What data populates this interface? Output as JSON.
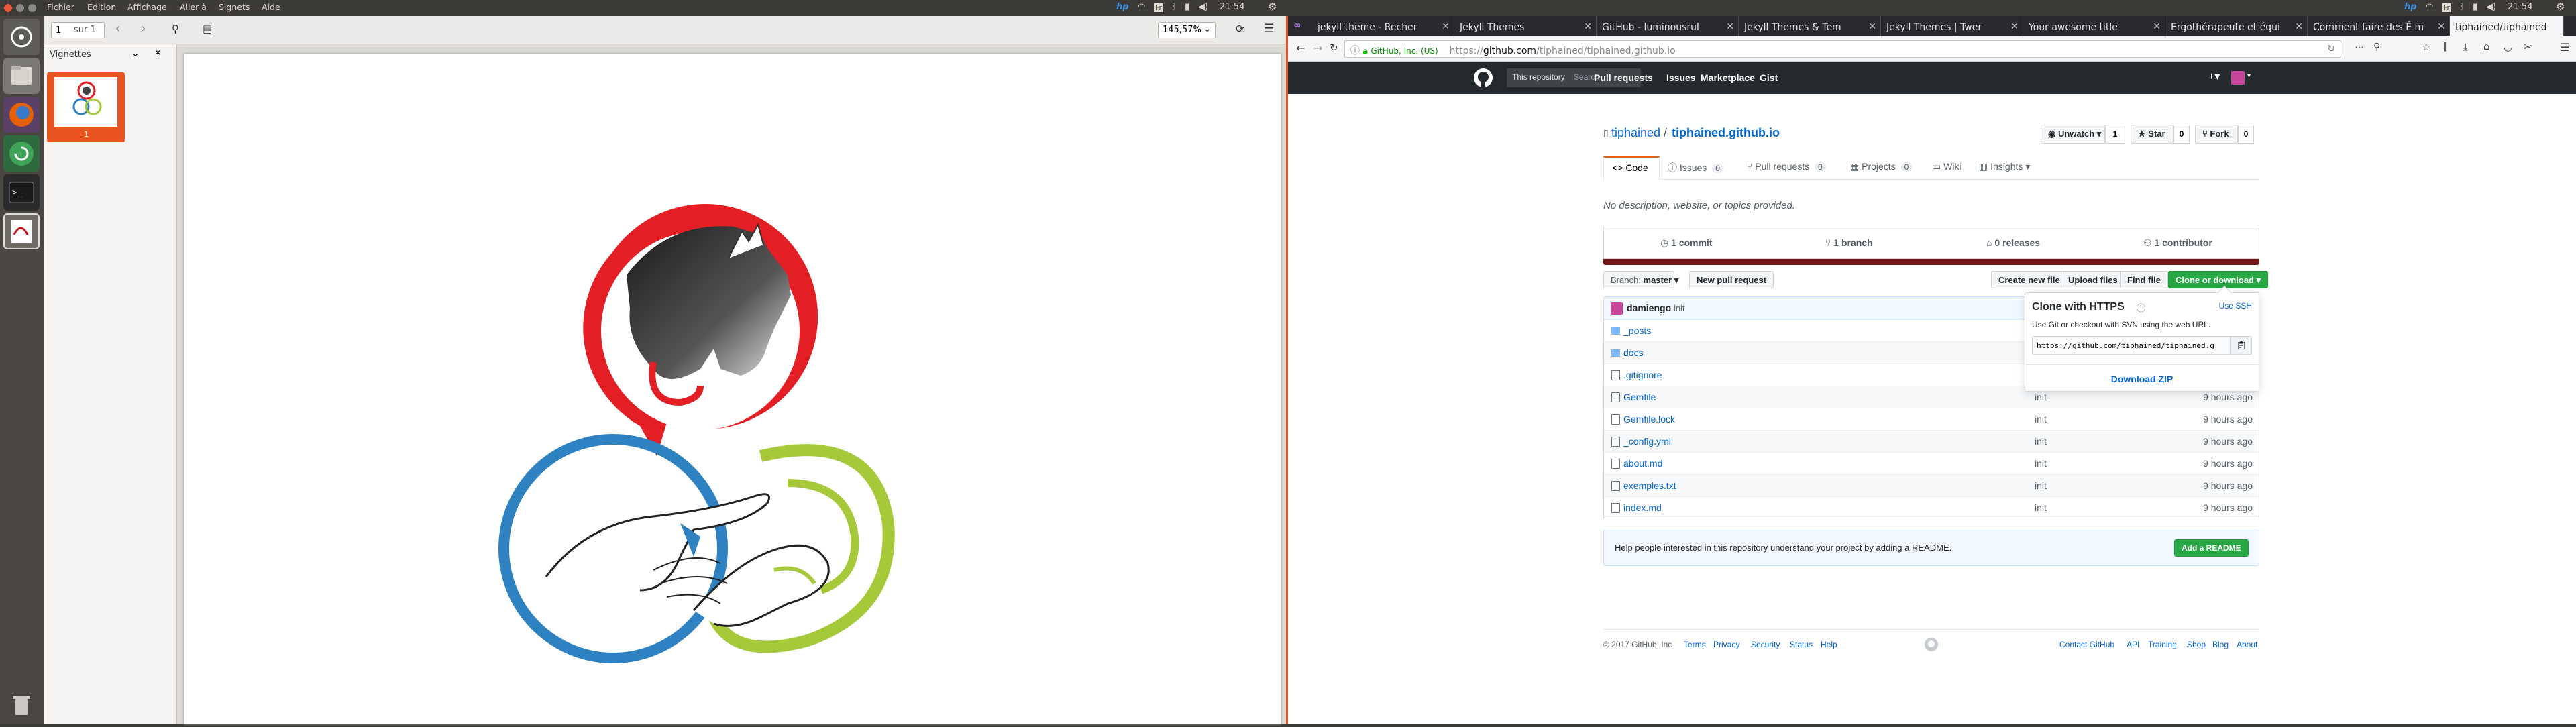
{
  "topbar": {
    "left_menu": [
      "Fichier",
      "Edition",
      "Affichage",
      "Aller à",
      "Signets",
      "Aide"
    ],
    "clock": "21:54"
  },
  "evince": {
    "page_input": "1",
    "page_total": "sur 1",
    "zoom": "145,57%",
    "sidebar_title": "Vignettes",
    "thumb_label": "1"
  },
  "colors": {
    "red": "#e31e24",
    "blue": "#2e82c1",
    "green": "#a6c93a",
    "gh_green": "#28a745",
    "gh_dark": "#24292e",
    "link": "#0366d6"
  },
  "firefox": {
    "tabs": [
      "jekyll theme - Recher",
      "Jekyll Themes",
      "GitHub - luminousrul",
      "Jekyll Themes & Tem",
      "Jekyll Themes | Twer",
      "Your awesome title",
      "Ergothérapeute et équi",
      "Comment faire des É m",
      "tiphained/tiphained"
    ],
    "identity": "GitHub, Inc. (US)",
    "url_prefix": "https://",
    "url_host": "github.com",
    "url_path": "/tiphained/tiphained.github.io"
  },
  "github": {
    "search_label": "This repository",
    "search_placeholder": "Search",
    "nav": [
      "Pull requests",
      "Issues",
      "Marketplace",
      "Gist"
    ],
    "owner": "tiphained",
    "sep": "/",
    "repo": "tiphained.github.io",
    "actions": [
      {
        "label": "Unwatch ▾",
        "count": "1"
      },
      {
        "label": "Star",
        "count": "0"
      },
      {
        "label": "Fork",
        "count": "0"
      }
    ],
    "tabs": [
      {
        "label": "Code",
        "count": ""
      },
      {
        "label": "Issues",
        "count": "0"
      },
      {
        "label": "Pull requests",
        "count": "0"
      },
      {
        "label": "Projects",
        "count": "0"
      },
      {
        "label": "Wiki",
        "count": ""
      },
      {
        "label": "Insights ▾",
        "count": ""
      }
    ],
    "description": "No description, website, or topics provided.",
    "summary": [
      "1 commit",
      "1 branch",
      "0 releases",
      "1 contributor"
    ],
    "branch_label": "Branch:",
    "branch": "master",
    "new_pr": "New pull request",
    "file_buttons": [
      "Create new file",
      "Upload files",
      "Find file"
    ],
    "clone_button": "Clone or download ▾",
    "commit_author": "damiengo",
    "commit_msg": "init",
    "files": [
      {
        "name": "_posts",
        "type": "dir",
        "msg": "",
        "time": ""
      },
      {
        "name": "docs",
        "type": "dir",
        "msg": "",
        "time": ""
      },
      {
        "name": ".gitignore",
        "type": "file",
        "msg": "",
        "time": ""
      },
      {
        "name": "Gemfile",
        "type": "file",
        "msg": "init",
        "time": "9 hours ago"
      },
      {
        "name": "Gemfile.lock",
        "type": "file",
        "msg": "init",
        "time": "9 hours ago"
      },
      {
        "name": "_config.yml",
        "type": "file",
        "msg": "init",
        "time": "9 hours ago"
      },
      {
        "name": "about.md",
        "type": "file",
        "msg": "init",
        "time": "9 hours ago"
      },
      {
        "name": "exemples.txt",
        "type": "file",
        "msg": "init",
        "time": "9 hours ago"
      },
      {
        "name": "index.md",
        "type": "file",
        "msg": "init",
        "time": "9 hours ago"
      }
    ],
    "clone": {
      "title": "Clone with HTTPS",
      "use_ssh": "Use SSH",
      "hint": "Use Git or checkout with SVN using the web URL.",
      "url": "https://github.com/tiphained/tiphained.g",
      "download": "Download ZIP"
    },
    "readme_text": "Help people interested in this repository understand your project by adding a README.",
    "readme_button": "Add a README",
    "footer_left": [
      "© 2017 GitHub, Inc.",
      "Terms",
      "Privacy",
      "Security",
      "Status",
      "Help"
    ],
    "footer_right": [
      "Contact GitHub",
      "API",
      "Training",
      "Shop",
      "Blog",
      "About"
    ]
  }
}
